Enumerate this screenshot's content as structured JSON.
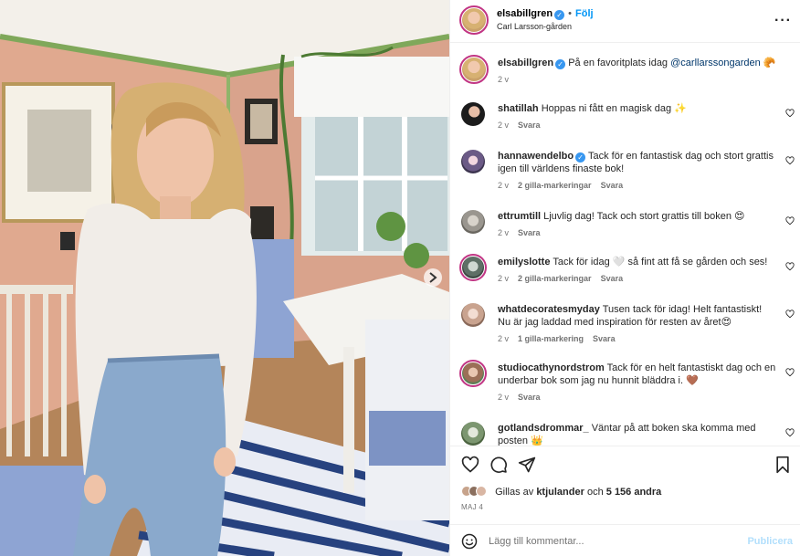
{
  "post": {
    "username": "elsabillgren",
    "location": "Carl Larsson-gården",
    "follow_label": "Följ",
    "dot": "•",
    "more_label": "···"
  },
  "caption": {
    "username": "elsabillgren",
    "text": "På en favoritplats idag",
    "mention": "@carllarssongarden",
    "emoji": "🥐",
    "time": "2 v"
  },
  "comments": [
    {
      "username": "shatillah",
      "verified": false,
      "text": "Hoppas ni fått en magisk dag ✨",
      "time": "2 v",
      "likes": "",
      "reply": "Svara"
    },
    {
      "username": "hannawendelbo",
      "verified": true,
      "text": "Tack för en fantastisk dag och stort grattis igen till världens finaste bok!",
      "time": "2 v",
      "likes": "2 gilla-markeringar",
      "reply": "Svara"
    },
    {
      "username": "ettrumtill",
      "verified": false,
      "text": "Ljuvlig dag! Tack och stort grattis till boken 😍",
      "time": "2 v",
      "likes": "",
      "reply": "Svara"
    },
    {
      "username": "emilyslotte",
      "verified": false,
      "text": "Tack för idag 🤍 så fint att få se gården och ses!",
      "time": "2 v",
      "likes": "2 gilla-markeringar",
      "reply": "Svara"
    },
    {
      "username": "whatdecoratesmyday",
      "verified": false,
      "text": "Tusen tack för idag! Helt fantastiskt! Nu är jag laddad med inspiration för resten av året😍",
      "time": "2 v",
      "likes": "1 gilla-markering",
      "reply": "Svara"
    },
    {
      "username": "studiocathynordstrom",
      "verified": false,
      "text": "Tack för en helt fantastiskt dag och en underbar bok som jag nu hunnit bläddra i. 🤎",
      "time": "2 v",
      "likes": "",
      "reply": "Svara"
    },
    {
      "username": "gotlandsdrommar_",
      "verified": false,
      "text": "Väntar på att boken ska komma med posten 👑",
      "time": "",
      "likes": "",
      "reply": ""
    }
  ],
  "likes": {
    "prefix": "Gillas av",
    "user": "ktjulander",
    "middle": "och",
    "count": "5 156 andra"
  },
  "date": "MAJ 4",
  "add_comment": {
    "placeholder": "Lägg till kommentar...",
    "publish": "Publicera"
  },
  "icons": {
    "verified": "verified-badge-icon",
    "more": "more-options-icon",
    "heart": "heart-icon",
    "comment": "comment-icon",
    "share": "share-icon",
    "save": "bookmark-icon",
    "emoji": "emoji-icon"
  },
  "colors": {
    "accent": "#0095f6",
    "verified": "#3897f0",
    "muted": "#737373",
    "publish_disabled": "#b2dffc",
    "story_ring": "#c13584"
  }
}
